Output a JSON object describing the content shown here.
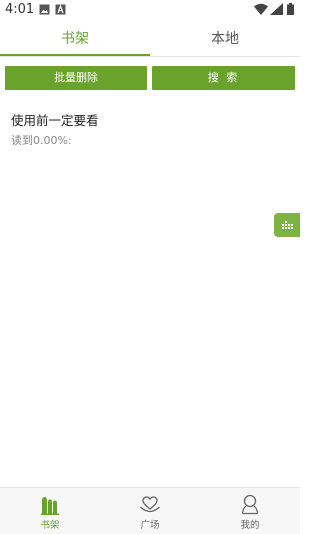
{
  "status_bar": {
    "time": "4:01",
    "icons": [
      "gallery-icon",
      "a-badge-icon",
      "wifi-icon",
      "signal-icon",
      "battery-icon"
    ]
  },
  "tabs": [
    {
      "label": "书架",
      "active": true
    },
    {
      "label": "本地",
      "active": false
    }
  ],
  "actions": {
    "delete_label": "批量删除",
    "search_label": "搜 索"
  },
  "books": [
    {
      "title": "使用前一定要看",
      "progress": "读到0.00%:"
    }
  ],
  "floating_button": {
    "icon": "equalizer-icon"
  },
  "bottom_nav": [
    {
      "label": "书架",
      "icon": "bookshelf-icon",
      "active": true
    },
    {
      "label": "广场",
      "icon": "heart-square-icon",
      "active": false
    },
    {
      "label": "我的",
      "icon": "profile-icon",
      "active": false
    }
  ],
  "colors": {
    "accent": "#6aa32b",
    "float_button": "#7cb342",
    "nav_background": "#f7f7f7"
  }
}
